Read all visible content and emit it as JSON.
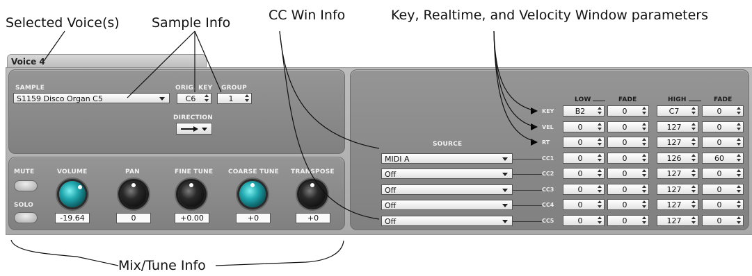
{
  "callouts": {
    "selected_voices": "Selected Voice(s)",
    "sample_info": "Sample Info",
    "cc_win_info": "CC Win Info",
    "key_rt_vel": "Key, Realtime, and Velocity Window parameters",
    "mix_tune": "Mix/Tune Info"
  },
  "tab": {
    "title": "Voice 4"
  },
  "sample": {
    "label": "SAMPLE",
    "value": "S1159 Disco Organ C5",
    "orig_key_label": "ORIG. KEY",
    "orig_key_value": "C6",
    "group_label": "GROUP",
    "group_value": "1",
    "direction_label": "DIRECTION",
    "direction_icon": "right-arrow-icon"
  },
  "mix": {
    "mute_label": "MUTE",
    "solo_label": "SOLO",
    "volume_label": "VOLUME",
    "volume_value": "-19.64",
    "pan_label": "PAN",
    "pan_value": "0",
    "fine_tune_label": "FINE TUNE",
    "fine_tune_value": "+0.00",
    "coarse_tune_label": "COARSE TUNE",
    "coarse_tune_value": "+0",
    "transpose_label": "TRANSPOSE",
    "transpose_value": "+0"
  },
  "windows": {
    "low_label": "LOW",
    "high_label": "HIGH",
    "fade_label": "FADE",
    "source_label": "SOURCE",
    "rows": [
      {
        "label": "KEY",
        "low": "B2",
        "low_fade": "0",
        "high": "C7",
        "high_fade": "0"
      },
      {
        "label": "VEL",
        "low": "0",
        "low_fade": "0",
        "high": "127",
        "high_fade": "0"
      },
      {
        "label": "RT",
        "low": "0",
        "low_fade": "0",
        "high": "127",
        "high_fade": "0"
      },
      {
        "label": "CC1",
        "source": "MIDI A",
        "low": "0",
        "low_fade": "0",
        "high": "126",
        "high_fade": "60"
      },
      {
        "label": "CC2",
        "source": "Off",
        "low": "0",
        "low_fade": "0",
        "high": "127",
        "high_fade": "0"
      },
      {
        "label": "CC3",
        "source": "Off",
        "low": "0",
        "low_fade": "0",
        "high": "127",
        "high_fade": "0"
      },
      {
        "label": "CC4",
        "source": "Off",
        "low": "0",
        "low_fade": "0",
        "high": "127",
        "high_fade": "0"
      },
      {
        "label": "CC5",
        "source": "Off",
        "low": "0",
        "low_fade": "0",
        "high": "127",
        "high_fade": "0"
      }
    ]
  },
  "colors": {
    "teal_knob": "#22a9b0",
    "panel": "#8a8a8a",
    "background": "#ffffff"
  }
}
